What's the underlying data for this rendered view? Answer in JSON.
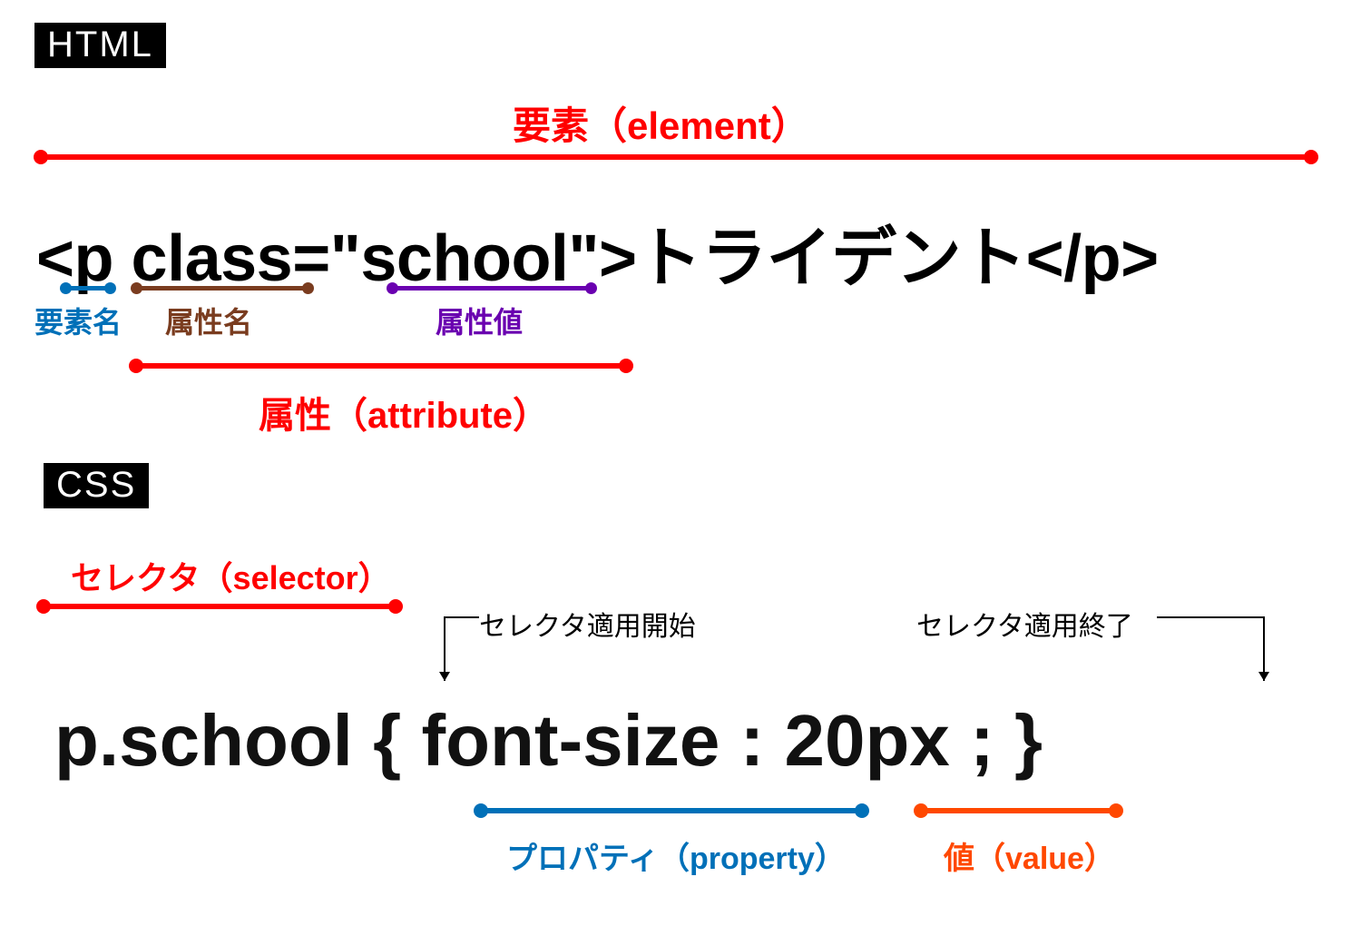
{
  "badges": {
    "html": "HTML",
    "css": "CSS"
  },
  "html_code": "<p class=\"school\">トライデント</p>",
  "css_code": "p.school { font-size : 20px ; }",
  "labels": {
    "element": "要素（element）",
    "element_name": "要素名",
    "attr_name": "属性名",
    "attr_value": "属性値",
    "attribute": "属性（attribute）",
    "selector": "セレクタ（selector）",
    "selector_start": "セレクタ適用開始",
    "selector_end": "セレクタ適用終了",
    "property": "プロパティ（property）",
    "value": "値（value）"
  }
}
